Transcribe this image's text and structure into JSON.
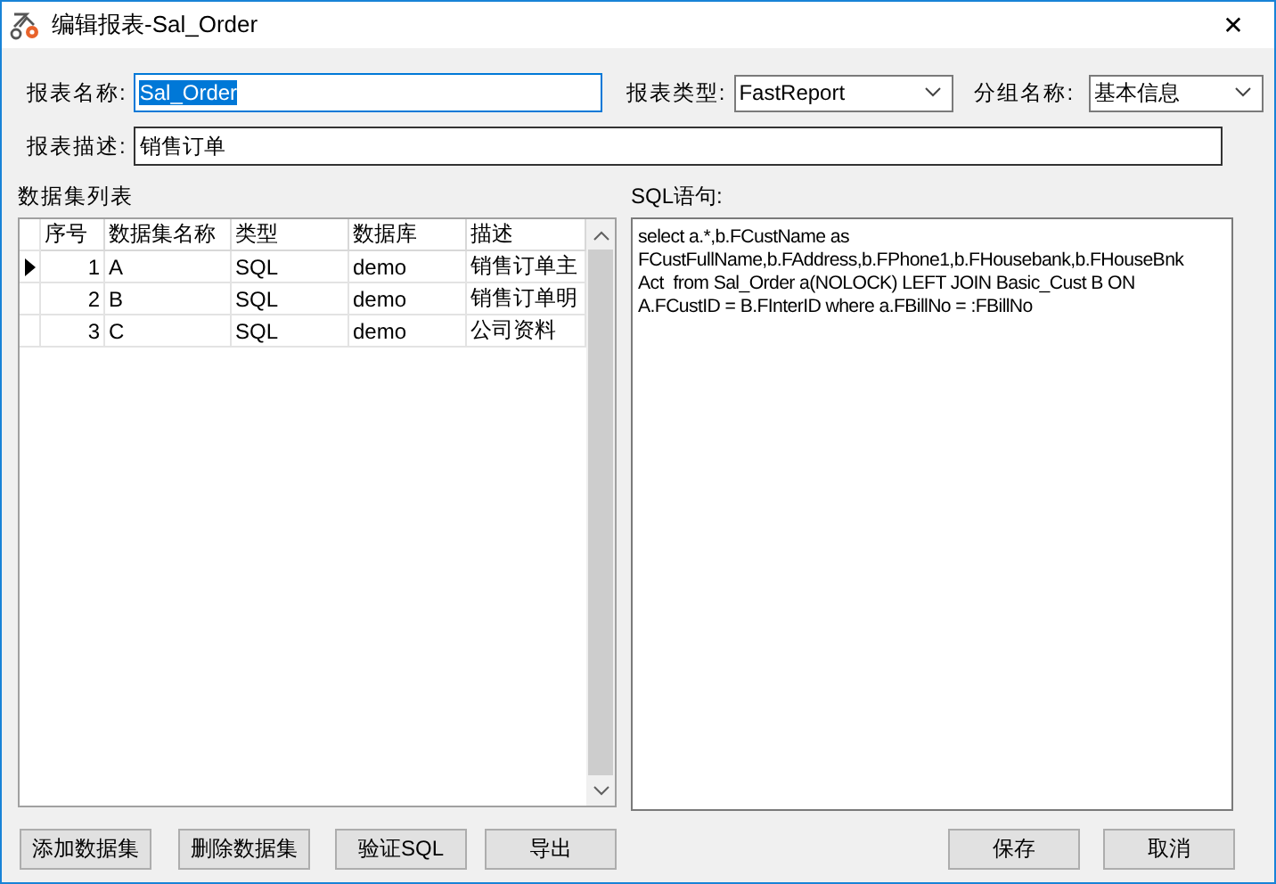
{
  "window": {
    "title": "编辑报表-Sal_Order",
    "close": "✕"
  },
  "form": {
    "name_label": "报表名称:",
    "name_value": "Sal_Order",
    "name_text_selected": true,
    "type_label": "报表类型:",
    "type_value": "FastReport",
    "group_label": "分组名称:",
    "group_value": "基本信息",
    "desc_label": "报表描述:",
    "desc_value": "销售订单"
  },
  "datasets": {
    "label": "数据集列表",
    "columns": [
      "序号",
      "数据集名称",
      "类型",
      "数据库",
      "描述"
    ],
    "rows": [
      {
        "cells": [
          "1",
          "A",
          "SQL",
          "demo",
          "销售订单主"
        ],
        "selected": true
      },
      {
        "cells": [
          "2",
          "B",
          "SQL",
          "demo",
          "销售订单明"
        ],
        "selected": false
      },
      {
        "cells": [
          "3",
          "C",
          "SQL",
          "demo",
          "公司资料"
        ],
        "selected": false
      }
    ]
  },
  "sql": {
    "label": "SQL语句:",
    "text": "select a.*,b.FCustName as\nFCustFullName,b.FAddress,b.FPhone1,b.FHousebank,b.FHouseBnk\nAct  from Sal_Order a(NOLOCK) LEFT JOIN Basic_Cust B ON\nA.FCustID = B.FInterID where a.FBillNo = :FBillNo"
  },
  "left_buttons": [
    "添加数据集",
    "删除数据集",
    "验证SQL",
    "导出"
  ],
  "right_buttons": [
    "保存",
    "取消"
  ]
}
